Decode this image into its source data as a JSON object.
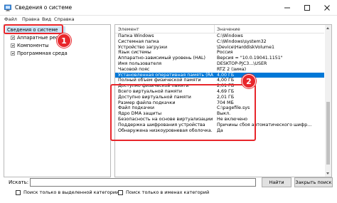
{
  "window": {
    "title": "Сведения о системе",
    "controls": [
      "minimize",
      "maximize",
      "close"
    ]
  },
  "menu": [
    "Файл",
    "Правка",
    "Вид",
    "Справка"
  ],
  "tree": {
    "root": "Сведения о системе",
    "children": [
      "Аппаратные ресурсы",
      "Компоненты",
      "Программная среда"
    ]
  },
  "list": {
    "columns": [
      "Элемент",
      "Значение"
    ],
    "rows": [
      {
        "item": "Папка Windows",
        "value": "C:\\Windows"
      },
      {
        "item": "Системная папка",
        "value": "C:\\Windows\\system32"
      },
      {
        "item": "Устройство загрузки",
        "value": "\\Device\\HarddiskVolume1"
      },
      {
        "item": "Язык системы",
        "value": "Россия"
      },
      {
        "item": "Аппаратно-зависимый уровень (HAL)",
        "value": "Версия = \"10.0.19041.1151\""
      },
      {
        "item": "Имя пользователя",
        "value": "DESKTOP-PJC3...\\USER"
      },
      {
        "item": "Часовой пояс",
        "value": "RTZ 2 (зима)"
      },
      {
        "item": "Установленная оперативная память (RAM)",
        "value": "4,00 ГБ"
      },
      {
        "item": "Полный объем физической памяти",
        "value": "4,00 ГБ"
      },
      {
        "item": "Доступно физической памяти",
        "value": "2,01 ГБ"
      },
      {
        "item": "Всего виртуальной памяти",
        "value": "4,69 ГБ"
      },
      {
        "item": "Доступно виртуальной памяти",
        "value": "2,01 ГБ"
      },
      {
        "item": "Размер файла подкачки",
        "value": "704 МБ"
      },
      {
        "item": "Файл подкачки",
        "value": "C:\\pagefile.sys"
      },
      {
        "item": "Ядро DMA защиты",
        "value": "Выкл."
      },
      {
        "item": "Безопасность на основе виртуализации",
        "value": "Не включено"
      },
      {
        "item": "Поддержка шифрования устройства",
        "value": "Причины сбоя автоматического шифр..."
      },
      {
        "item": "Обнаружена низкоуровневая оболочка. Фун...",
        "value": "Да"
      }
    ],
    "selected_index": 7
  },
  "search": {
    "label": "Искать:",
    "value": "",
    "find_button": "Найти",
    "close_button": "Закрыть поиск",
    "option_selected_category": "Поиск только в выделенной категории",
    "option_category_names": "Поиск только в именах категорий"
  },
  "annotations": {
    "badge1": "1",
    "badge2": "2",
    "color": "#e8262b"
  },
  "colors": {
    "selection": "#0078d7",
    "tree_selection": "#cce4f7"
  }
}
